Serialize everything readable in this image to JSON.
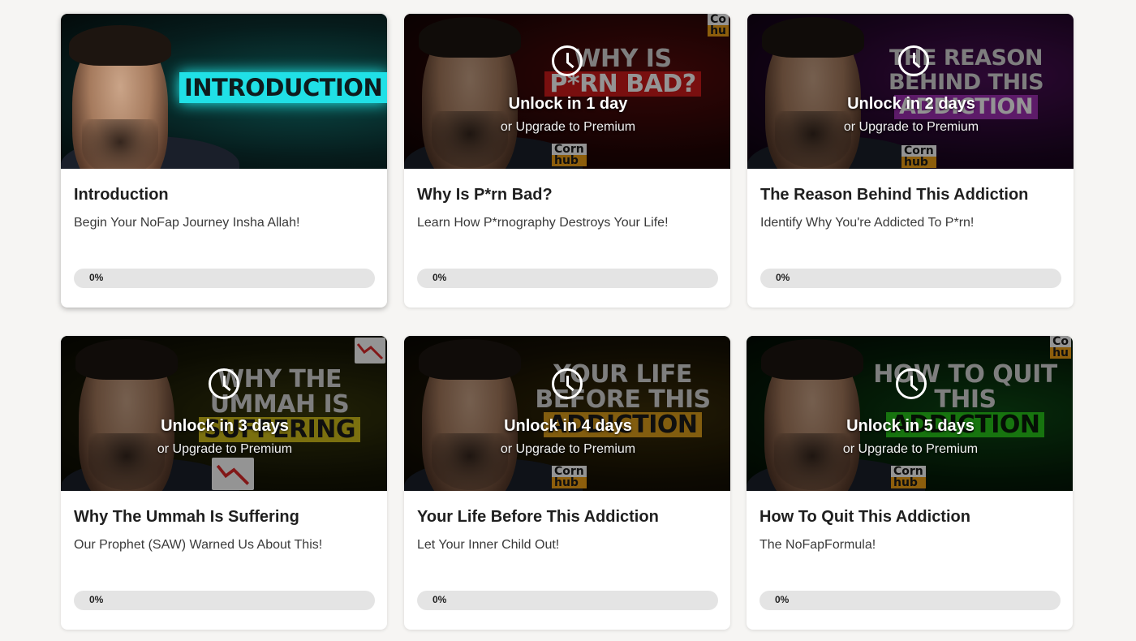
{
  "colors": {
    "page_bg": "#f6f5f3",
    "card_bg": "#ffffff",
    "progress_track": "#e4e4e4",
    "intro_banner": "#20e0e6"
  },
  "overlay": {
    "upgrade_text": "or Upgrade to Premium",
    "icon": "clock-icon"
  },
  "lessons": [
    {
      "title": "Introduction",
      "subtitle": "Begin Your NoFap Journey Insha Allah!",
      "progress": 0,
      "progress_label": "0%",
      "locked": false,
      "thumb_text": "INTRODUCTION",
      "thumb_bg": "#0a2a2a"
    },
    {
      "title": "Why Is P*rn Bad?",
      "subtitle": "Learn How P*rnography Destroys Your Life!",
      "progress": 0,
      "progress_label": "0%",
      "locked": true,
      "unlock_text": "Unlock in 1 day",
      "thumb_line1": "WHY IS",
      "thumb_line2": "P*RN BAD?",
      "thumb_bg": "#3a0a0a",
      "thumb_accent": "#d01a1a"
    },
    {
      "title": "The Reason Behind This Addiction",
      "subtitle": "Identify Why You're Addicted To P*rn!",
      "progress": 0,
      "progress_label": "0%",
      "locked": true,
      "unlock_text": "Unlock in 2 days",
      "thumb_line1": "THE REASON BEHIND THIS",
      "thumb_line2": "ADDICTION",
      "thumb_bg": "#2a0a32",
      "thumb_accent": "#a02fb5"
    },
    {
      "title": "Why The Ummah Is Suffering",
      "subtitle": "Our Prophet (SAW) Warned Us About This!",
      "progress": 0,
      "progress_label": "0%",
      "locked": true,
      "unlock_text": "Unlock in 3 days",
      "thumb_line1": "WHY THE UMMAH IS",
      "thumb_line2": "SUFFERING",
      "thumb_bg": "#1c1f0a",
      "thumb_accent": "#d4c21a"
    },
    {
      "title": "Your Life Before This Addiction",
      "subtitle": "Let Your Inner Child Out!",
      "progress": 0,
      "progress_label": "0%",
      "locked": true,
      "unlock_text": "Unlock in 4 days",
      "thumb_line1": "YOUR LIFE BEFORE THIS",
      "thumb_line2": "ADDICTION",
      "thumb_bg": "#23200a",
      "thumb_accent": "#e0a01a"
    },
    {
      "title": "How To Quit This Addiction",
      "subtitle": "The NoFapFormula!",
      "progress": 0,
      "progress_label": "0%",
      "locked": true,
      "unlock_text": "Unlock in 5 days",
      "thumb_line1": "HOW TO QUIT THIS",
      "thumb_line2": "ADDICTION",
      "thumb_bg": "#0a2a10",
      "thumb_accent": "#28c81a"
    }
  ]
}
